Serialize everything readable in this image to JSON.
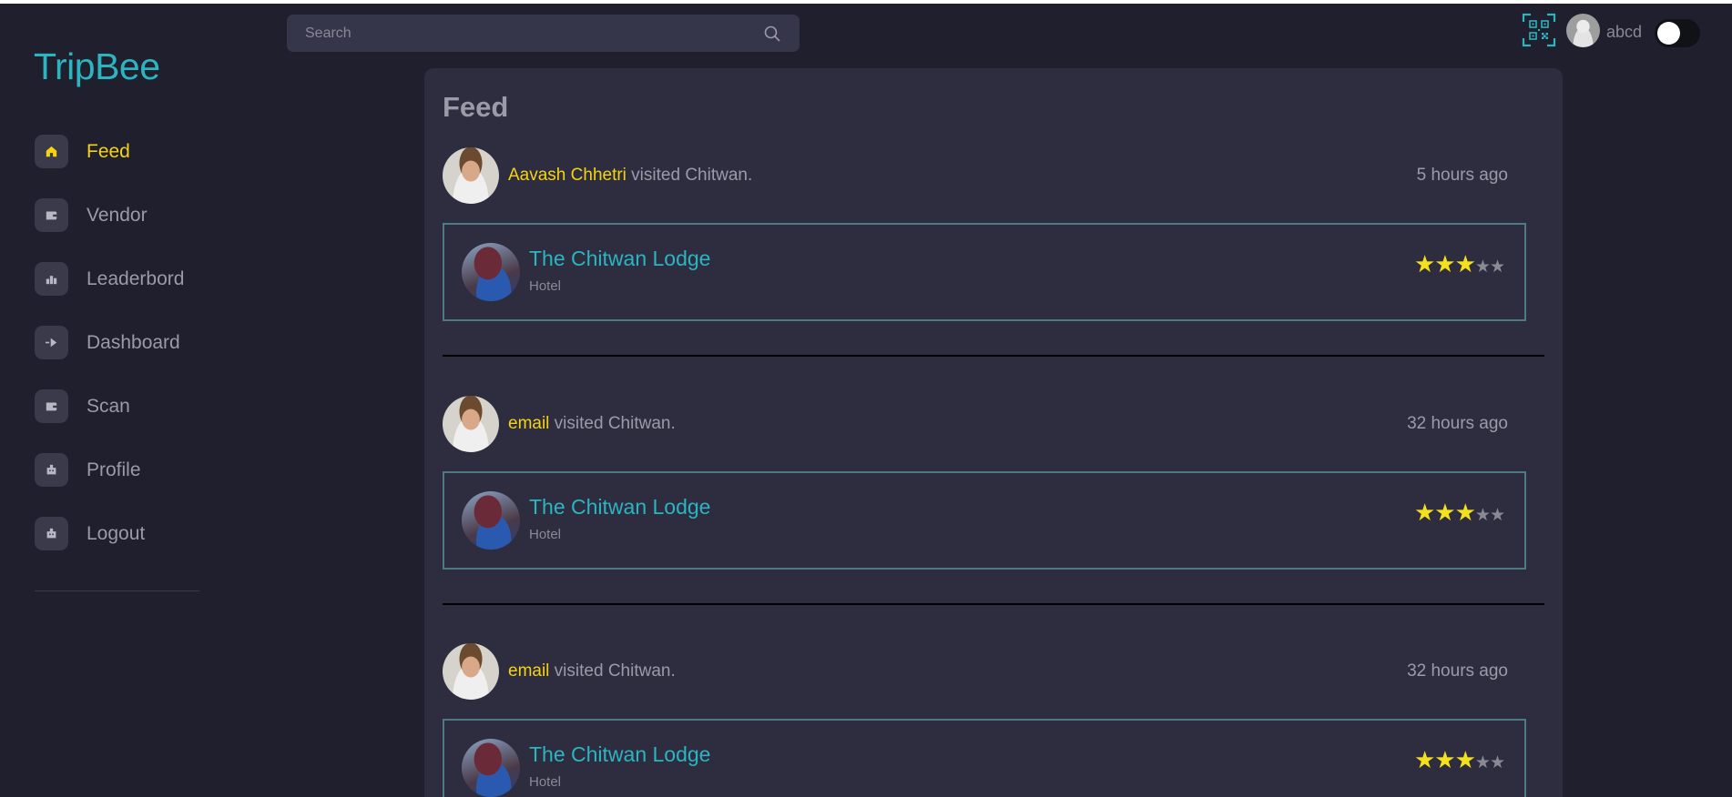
{
  "app": {
    "name": "TripBee"
  },
  "colors": {
    "accent": "#2ab5c0",
    "active": "#f5d313",
    "star": "#f5e11b"
  },
  "sidebar": {
    "items": [
      {
        "label": "Feed",
        "icon": "home-icon",
        "active": true
      },
      {
        "label": "Vendor",
        "icon": "wallet-icon",
        "active": false
      },
      {
        "label": "Leaderbord",
        "icon": "bar-chart-icon",
        "active": false
      },
      {
        "label": "Dashboard",
        "icon": "arrow-right-icon",
        "active": false
      },
      {
        "label": "Scan",
        "icon": "wallet-icon",
        "active": false
      },
      {
        "label": "Profile",
        "icon": "user-box-icon",
        "active": false
      },
      {
        "label": "Logout",
        "icon": "user-box-icon",
        "active": false
      }
    ]
  },
  "header": {
    "search_placeholder": "Search",
    "search_value": "",
    "username": "abcd",
    "dark_mode_toggle": false
  },
  "feed": {
    "title": "Feed",
    "posts": [
      {
        "user": "Aavash Chhetri",
        "action": " visited Chitwan.",
        "time": "5 hours ago",
        "vendor": {
          "name": "The Chitwan Lodge",
          "type": "Hotel",
          "rating": 3,
          "max_rating": 5
        }
      },
      {
        "user": "email",
        "action": " visited Chitwan.",
        "time": "32 hours ago",
        "vendor": {
          "name": "The Chitwan Lodge",
          "type": "Hotel",
          "rating": 3,
          "max_rating": 5
        }
      },
      {
        "user": "email",
        "action": " visited Chitwan.",
        "time": "32 hours ago",
        "vendor": {
          "name": "The Chitwan Lodge",
          "type": "Hotel",
          "rating": 3,
          "max_rating": 5
        }
      }
    ]
  }
}
